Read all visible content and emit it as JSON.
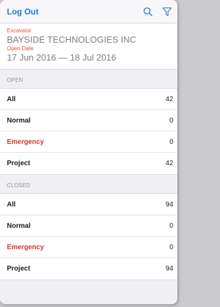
{
  "navbar": {
    "logout_label": "Log Out",
    "icons": [
      "search-icon",
      "filter-icon"
    ],
    "accent": "#1f7ad8"
  },
  "header": {
    "type_label": "Excavator",
    "company": "BAYSIDE TECHNOLOGIES INC",
    "date_label": "Open Date",
    "date_range": "17 Jun 2016 — 18 Jul 2016"
  },
  "sections": {
    "open": {
      "label": "OPEN",
      "rows": [
        {
          "label": "All",
          "count": "42"
        },
        {
          "label": "Normal",
          "count": "0"
        },
        {
          "label": "Emergency",
          "count": "0"
        },
        {
          "label": "Project",
          "count": "42"
        }
      ]
    },
    "closed": {
      "label": "CLOSED",
      "rows": [
        {
          "label": "All",
          "count": "94"
        },
        {
          "label": "Normal",
          "count": "0"
        },
        {
          "label": "Emergency",
          "count": "0"
        },
        {
          "label": "Project",
          "count": "94"
        }
      ]
    }
  },
  "colors": {
    "emergency": "#e0302a",
    "header_label": "#e8493b"
  }
}
